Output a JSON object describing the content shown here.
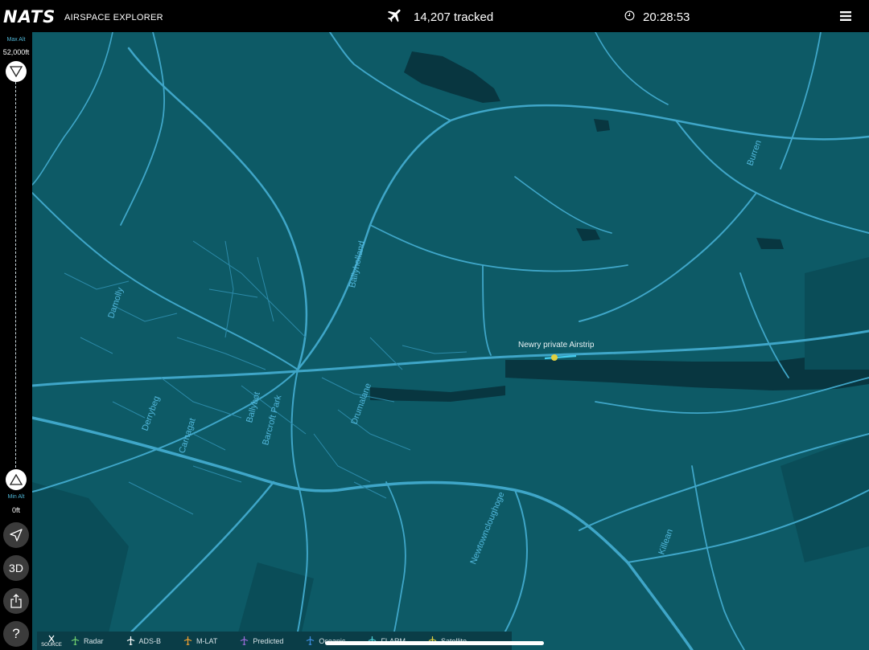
{
  "header": {
    "logo": "NATS",
    "app_name": "AIRSPACE EXPLORER",
    "tracked_count": "14,207 tracked",
    "time": "20:28:53"
  },
  "sidebar": {
    "max_alt_label": "Max Alt",
    "max_alt_value": "52,000ft",
    "min_alt_label": "Min Alt",
    "min_alt_value": "0ft",
    "three_d_label": "3D",
    "help_label": "?"
  },
  "map": {
    "airstrip": "Newry private Airstrip",
    "places": {
      "damolly": "Damolly",
      "ballyholland": "Ballyholland",
      "derrybeg": "Derrybeg",
      "carnagat": "Carnagat",
      "ballybot": "Ballybot",
      "barcroft_park": "Barcroft Park",
      "drumalane": "Drumalane",
      "newtowncloughoge": "Newtowncloughoge",
      "killean": "Killean",
      "burren": "Burren"
    }
  },
  "legend": {
    "source": "SOURCE",
    "items": [
      {
        "label": "Radar",
        "color": "#6fcf6f"
      },
      {
        "label": "ADS-B",
        "color": "#ffffff"
      },
      {
        "label": "M-LAT",
        "color": "#f0a030"
      },
      {
        "label": "Predicted",
        "color": "#9a6bd8"
      },
      {
        "label": "Oceanic",
        "color": "#3d8de0"
      },
      {
        "label": "FLARM",
        "color": "#4fd0d8"
      },
      {
        "label": "Satellite",
        "color": "#e0d040"
      }
    ]
  },
  "colors": {
    "map_background": "#0d5a66",
    "road": "#3fa6c8",
    "water": "#083640",
    "place_label": "#52b8dc"
  }
}
